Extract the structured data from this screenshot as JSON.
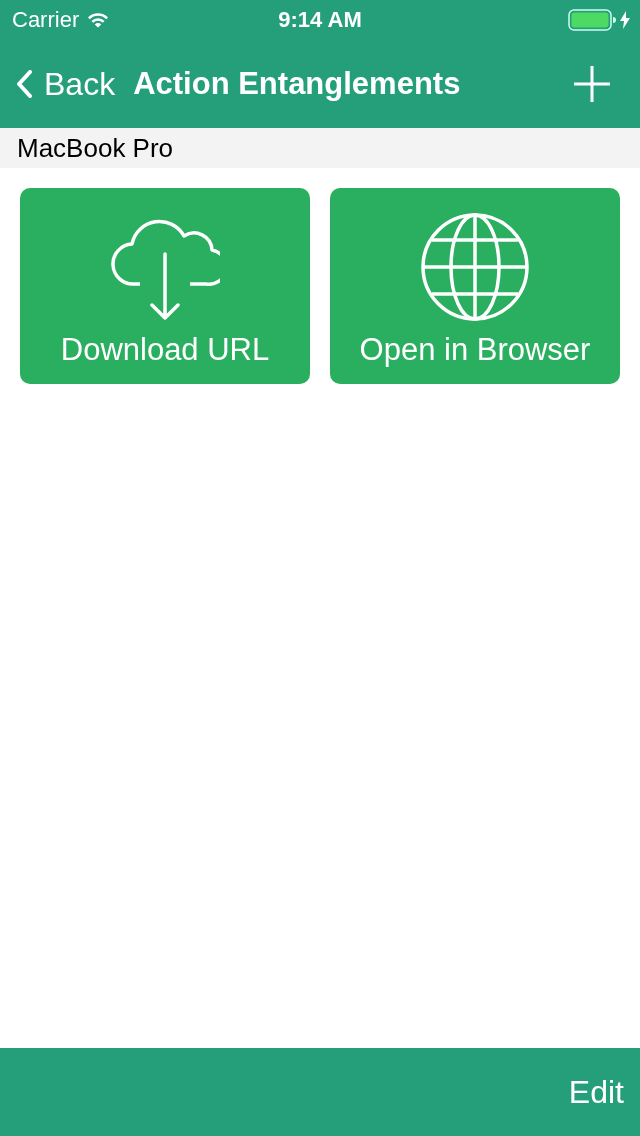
{
  "status_bar": {
    "carrier": "Carrier",
    "time": "9:14 AM",
    "charging": true
  },
  "nav_bar": {
    "back": "Back",
    "title": "Action Entanglements"
  },
  "section": {
    "title": "MacBook Pro"
  },
  "actions": [
    {
      "kind": "download",
      "label": "Download URL"
    },
    {
      "kind": "browser",
      "label": "Open in Browser"
    }
  ],
  "toolbar": {
    "edit": "Edit"
  }
}
